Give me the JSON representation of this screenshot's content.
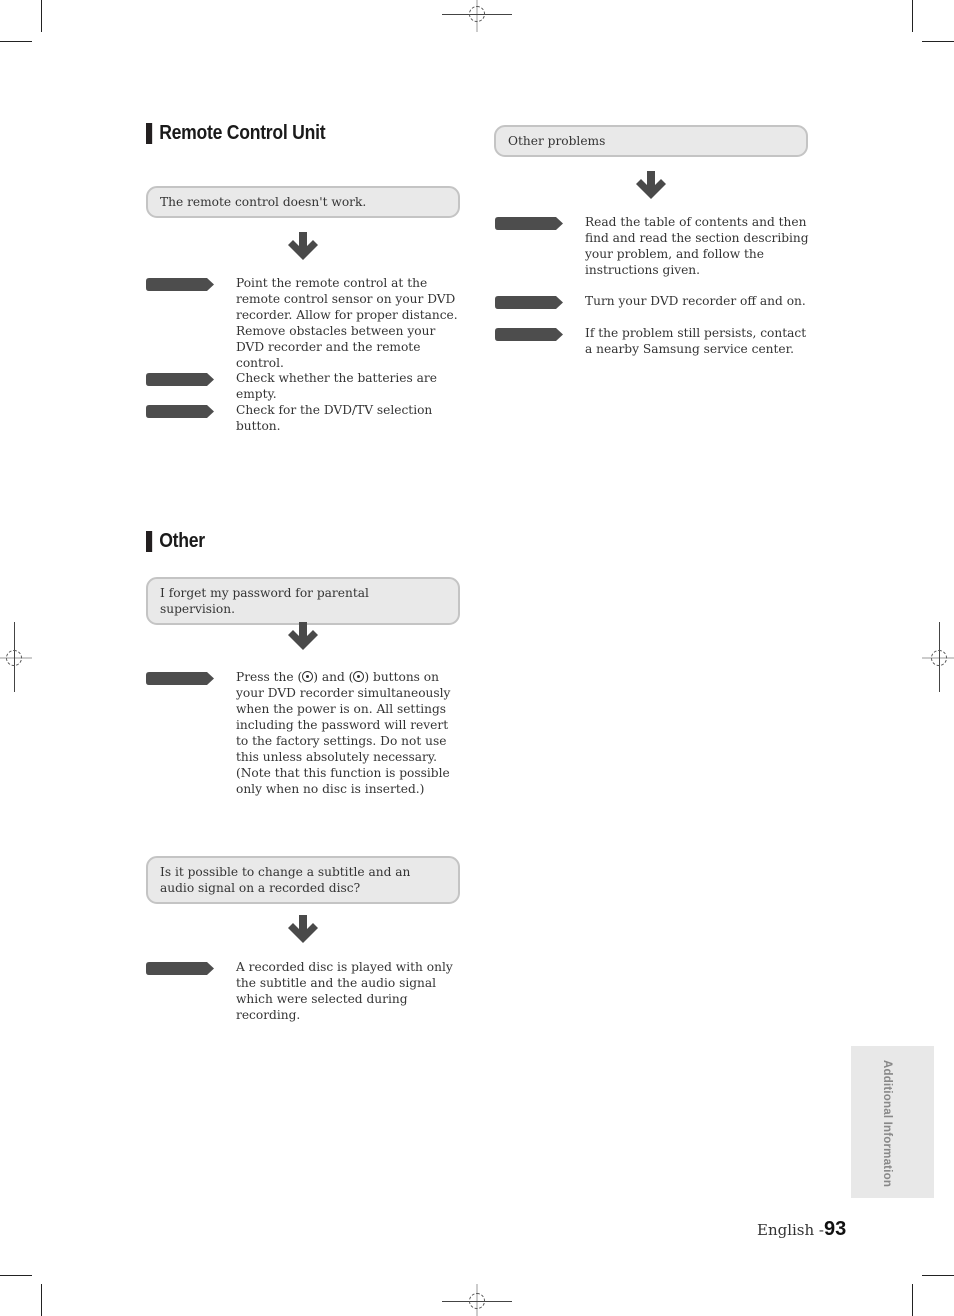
{
  "sections": {
    "remote": {
      "title": "Remote Control Unit",
      "question": "The remote control doesn't work.",
      "steps": [
        "Point the remote control at the remote control sensor on your DVD recorder. Allow for proper distance. Remove obstacles between your DVD recorder and the remote control.",
        "Check whether the batteries are empty.",
        "Check for the DVD/TV selection button."
      ]
    },
    "other_problems": {
      "question": "Other problems",
      "steps": [
        "Read the table of contents and then find and read the section describing your problem, and follow the instructions given.",
        "Turn your DVD recorder off and on.",
        "If the problem still persists, contact a nearby Samsung service center."
      ]
    },
    "other": {
      "title": "Other",
      "password": {
        "question": "I forget my password for parental supervision.",
        "step_prefix": "Press the (",
        "step_mid": ") and (",
        "step_suffix": ") buttons on your DVD recorder simultaneously when the power is on. All settings including the password will revert to the factory settings. Do not use this unless absolutely necessary.",
        "step_note": "(Note that this function is possible only when no disc is inserted.)",
        "button_icons": [
          "skip-button-icon",
          "stop-button-icon"
        ]
      },
      "subtitle": {
        "question": "Is it possible to change a subtitle and an audio signal on a recorded disc?",
        "steps": [
          "A recorded disc is played with only the subtitle and the audio signal which were selected during recording."
        ]
      }
    }
  },
  "side_tab": {
    "label": "Additional Information"
  },
  "footer": {
    "language": "English -",
    "page_number": "93"
  },
  "colors": {
    "marker": "#4d4d4d",
    "question_bg": "#e9e9e9",
    "question_border": "#c4c4c4",
    "side_tab_bg": "#e8e8e8"
  }
}
